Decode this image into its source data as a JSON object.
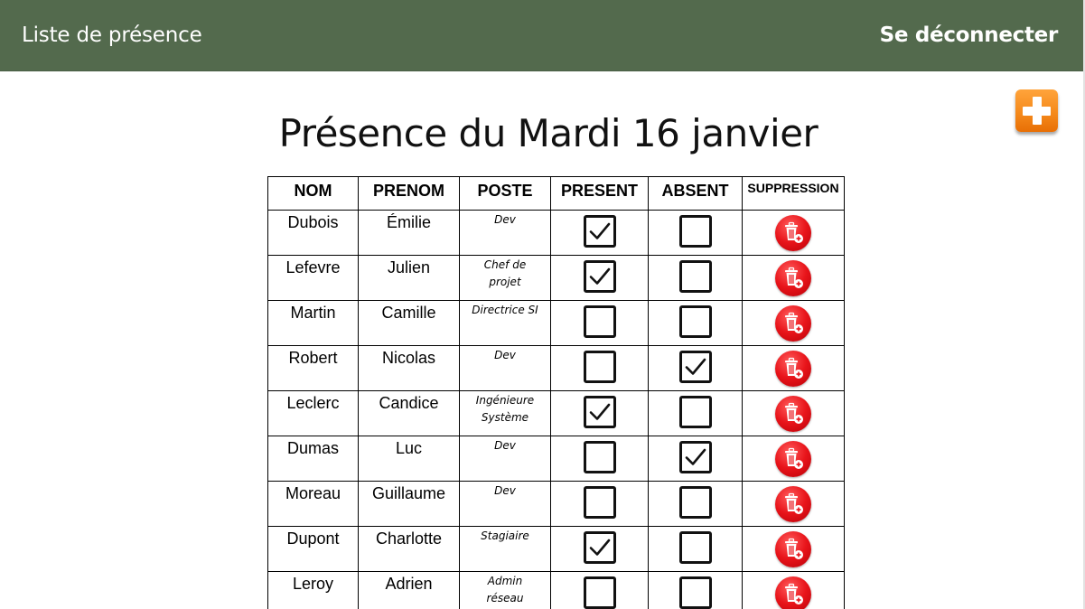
{
  "navbar": {
    "title": "Liste de présence",
    "logout_label": "Se déconnecter"
  },
  "page": {
    "title": "Présence du Mardi 16 janvier"
  },
  "add_button": {
    "icon": "plus-icon",
    "color": "#f58a1c"
  },
  "table": {
    "headers": {
      "nom": "NOM",
      "prenom": "PRENOM",
      "poste": "POSTE",
      "present": "PRESENT",
      "absent": "ABSENT",
      "suppression": "SUPPRESSION"
    },
    "rows": [
      {
        "nom": "Dubois",
        "prenom": "Émilie",
        "poste_line1": "Dev",
        "poste_line2": "",
        "present": true,
        "absent": false
      },
      {
        "nom": "Lefevre",
        "prenom": "Julien",
        "poste_line1": "Chef de",
        "poste_line2": "projet",
        "present": true,
        "absent": false
      },
      {
        "nom": "Martin",
        "prenom": "Camille",
        "poste_line1": "Directrice SI",
        "poste_line2": "",
        "present": false,
        "absent": false
      },
      {
        "nom": "Robert",
        "prenom": "Nicolas",
        "poste_line1": "Dev",
        "poste_line2": "",
        "present": false,
        "absent": true
      },
      {
        "nom": "Leclerc",
        "prenom": "Candice",
        "poste_line1": "Ingénieure",
        "poste_line2": "Système",
        "present": true,
        "absent": false
      },
      {
        "nom": "Dumas",
        "prenom": "Luc",
        "poste_line1": "Dev",
        "poste_line2": "",
        "present": false,
        "absent": true
      },
      {
        "nom": "Moreau",
        "prenom": "Guillaume",
        "poste_line1": "Dev",
        "poste_line2": "",
        "present": false,
        "absent": false
      },
      {
        "nom": "Dupont",
        "prenom": "Charlotte",
        "poste_line1": "Stagiaire",
        "poste_line2": "",
        "present": true,
        "absent": false
      },
      {
        "nom": "Leroy",
        "prenom": "Adrien",
        "poste_line1": "Admin",
        "poste_line2": "réseau",
        "present": false,
        "absent": false
      }
    ],
    "delete_icon": "trash-icon",
    "delete_color": "#e8141a",
    "checkmark_icon": "checkmark-icon"
  }
}
